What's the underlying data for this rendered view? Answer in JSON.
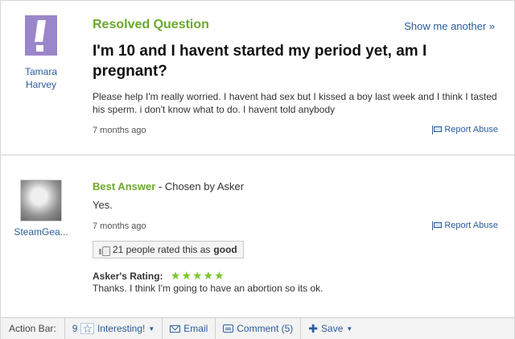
{
  "question": {
    "user_name_line1": "Tamara",
    "user_name_line2": "Harvey",
    "status": "Resolved Question",
    "show_another": "Show me another »",
    "title": "I'm 10 and I havent started my period yet, am I pregnant?",
    "body": "Please help I'm really worried. I havent had sex but I kissed a boy last week and I think I tasted his sperm. i don't know what to do. I havent told anybody",
    "timestamp": "7 months ago",
    "report_abuse": "Report Abuse"
  },
  "answer": {
    "user_name": "SteamGea...",
    "best_label": "Best Answer",
    "chosen_by": " - Chosen by Asker",
    "body": "Yes.",
    "timestamp": "7 months ago",
    "report_abuse": "Report Abuse",
    "rating_count_text": "21 people rated this as",
    "rating_word": "good",
    "askers_rating_label": "Asker's Rating:",
    "askers_rating_stars": "★★★★★",
    "askers_rating_value": 5,
    "askers_comment": "Thanks. I think I'm going to have an abortion so its ok."
  },
  "action_bar": {
    "label": "Action Bar:",
    "interesting_count": "9",
    "interesting_label": "Interesting!",
    "email_label": "Email",
    "comment_label": "Comment (5)",
    "save_label": "Save"
  },
  "icons": {
    "question_avatar": "exclamation-avatar-icon",
    "flag": "flag-icon",
    "thumb": "thumbs-up-icon",
    "star": "star-icon",
    "mail": "mail-icon",
    "comment": "comment-icon",
    "plus": "plus-icon"
  },
  "colors": {
    "accent_green": "#6aaa2b",
    "link_blue": "#2b5d9b",
    "avatar_purple": "#9b86c9",
    "rating_star_green": "#7cc72f"
  }
}
